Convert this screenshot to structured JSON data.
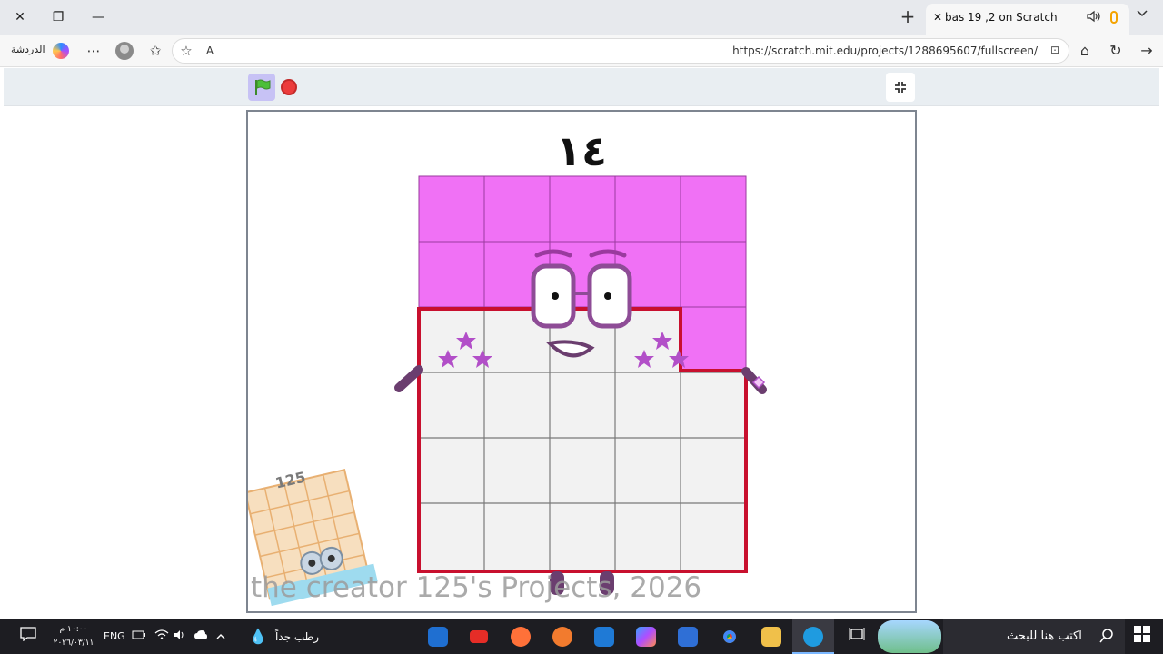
{
  "browser": {
    "tab_title": "bas 19 ,2 on Scratch",
    "tab_close_glyph": "✕",
    "new_tab_glyph": "+",
    "tab_menu_glyph": "⌵",
    "window_close_glyph": "✕",
    "window_restore_glyph": "❐",
    "window_minimize_glyph": "—",
    "chat_label": "الدردشة",
    "more_glyph": "⋯",
    "favorites_glyph": "✩",
    "star_glyph": "☆",
    "read_aloud_glyph": "A",
    "url": "https://scratch.mit.edu/projects/1288695607/fullscreen/",
    "home_glyph": "⌂",
    "refresh_glyph": "↻",
    "forward_glyph": "→",
    "lock_glyph": "⊡",
    "sound_glyph": "🔈"
  },
  "player": {
    "exit_fullscreen_glyph": "⤡"
  },
  "stage": {
    "number_label": "١٤",
    "mini_label": "125",
    "credit_text": "the creator 125's Projects, 2026",
    "colors": {
      "magenta": "#f071f5",
      "red_outline": "#c8102e",
      "grid_fill": "#f2f2f2",
      "purple": "#6b3e6f",
      "star": "#b24fc8"
    }
  },
  "taskbar": {
    "time": "١٠:٠٠ م",
    "date": "٢٠٢٦/٠٣/١١",
    "language": "ENG",
    "weather": "رطب جداً",
    "search_placeholder": "اكتب هنا للبحث",
    "colors": {
      "youtube": "#e52d27",
      "firefox": "#ff7139",
      "chrome": "#4285f4",
      "edge": "#1f9be0",
      "files": "#f0c04a",
      "store": "#2f6fd6"
    }
  }
}
